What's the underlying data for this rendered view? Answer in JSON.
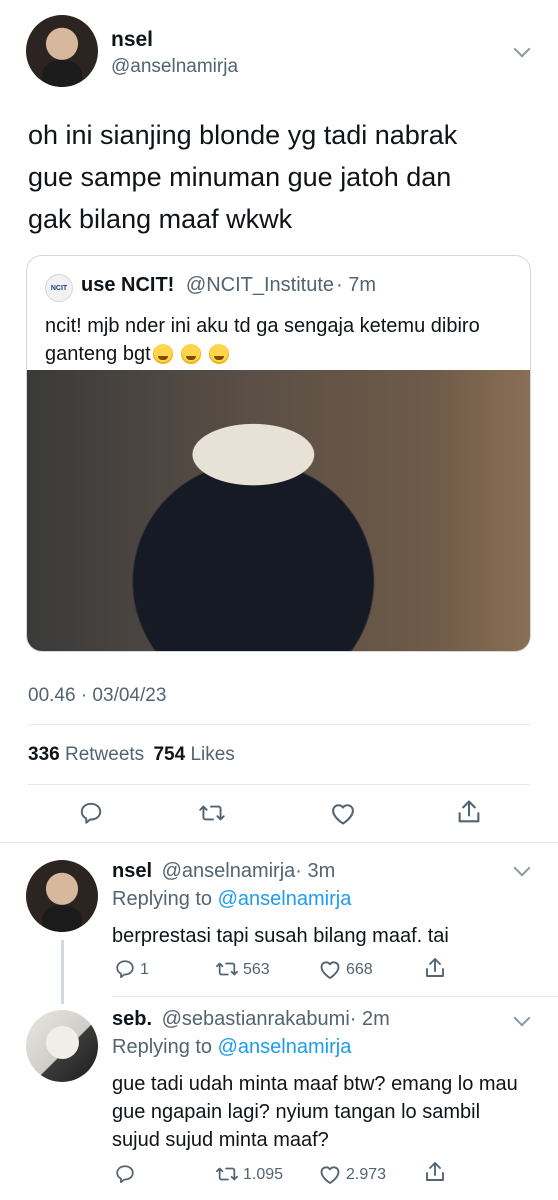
{
  "main_tweet": {
    "display_name": "nsel",
    "handle": "@anselnamirja",
    "text": "oh ini sianjing blonde yg tadi nabrak gue sampe minuman gue jatoh dan gak bilang maaf wkwk",
    "time_date": "00.46 · 03/04/23",
    "retweets_count": "336",
    "retweets_label": "Retweets",
    "likes_count": "754",
    "likes_label": "Likes"
  },
  "quoted_tweet": {
    "logo_text": "NCIT",
    "display_name": "use NCIT!",
    "handle": "@NCIT_Institute",
    "time": "· 7m",
    "text": "ncit! mjb nder ini aku td ga sengaja ketemu dibiro ganteng bgt"
  },
  "replies": [
    {
      "display_name": "nsel",
      "handle": "@anselnamirja",
      "time": "· 3m",
      "replying_prefix": "Replying to",
      "replying_to": "@anselnamirja",
      "text": "berprestasi tapi susah bilang maaf. tai",
      "reply_count": "1",
      "retweet_count": "563",
      "like_count": "668"
    },
    {
      "display_name": "seb.",
      "handle": "@sebastianrakabumi",
      "time": "· 2m",
      "replying_prefix": "Replying to",
      "replying_to": "@anselnamirja",
      "text": "gue tadi udah minta maaf btw? emang lo mau gue ngapain lagi? nyium tangan lo sambil sujud sujud minta maaf?",
      "reply_count": "",
      "retweet_count": "1.095",
      "like_count": "2.973"
    }
  ],
  "icons": [
    "reply-icon",
    "retweet-icon",
    "like-icon",
    "share-icon",
    "chevron-down-icon"
  ],
  "colors": {
    "text": "#0f1419",
    "secondary": "#536471",
    "link": "#1d9bf0",
    "divider": "#e6e9ec"
  }
}
